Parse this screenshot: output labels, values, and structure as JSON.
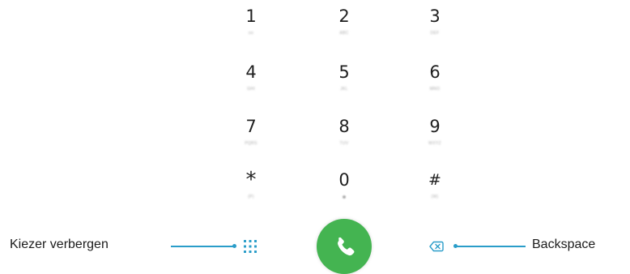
{
  "keypad": {
    "keys": [
      {
        "digit": "1",
        "letters": "oo"
      },
      {
        "digit": "2",
        "letters": "ABC"
      },
      {
        "digit": "3",
        "letters": "DEF"
      },
      {
        "digit": "4",
        "letters": "GHI"
      },
      {
        "digit": "5",
        "letters": "JKL"
      },
      {
        "digit": "6",
        "letters": "MNO"
      },
      {
        "digit": "7",
        "letters": "PQRS"
      },
      {
        "digit": "8",
        "letters": "TUV"
      },
      {
        "digit": "9",
        "letters": "WXYZ"
      },
      {
        "digit": "*",
        "letters": "(P)"
      },
      {
        "digit": "0",
        "letters": ""
      },
      {
        "digit": "#",
        "letters": "(W)"
      }
    ]
  },
  "callouts": {
    "hide_keypad": "Kiezer verbergen",
    "backspace": "Backspace"
  },
  "colors": {
    "call_button": "#44b451",
    "leader_line": "#2a9dc9",
    "grid_icon": "#2a9dc9"
  },
  "icons": {
    "hide_keypad": "dialpad-grid-icon",
    "call": "phone-handset-icon",
    "backspace": "backspace-icon"
  }
}
